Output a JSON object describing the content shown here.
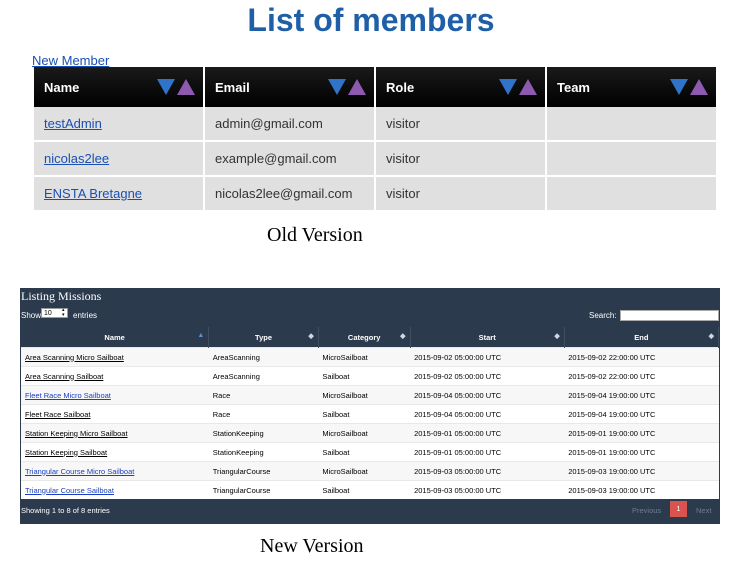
{
  "old": {
    "title": "List of members",
    "new_member_label": "New Member",
    "columns": [
      "Name",
      "Email",
      "Role",
      "Team"
    ],
    "rows": [
      {
        "name": "testAdmin",
        "email": "admin@gmail.com",
        "role": "visitor",
        "team": ""
      },
      {
        "name": "nicolas2lee",
        "email": "example@gmail.com",
        "role": "visitor",
        "team": ""
      },
      {
        "name": "ENSTA Bretagne",
        "email": "nicolas2lee@gmail.com",
        "role": "visitor",
        "team": ""
      }
    ],
    "caption": "Old Version"
  },
  "new": {
    "title": "Listing Missions",
    "show_label": "Show",
    "entries_value": "10",
    "entries_label": "entries",
    "search_label": "Search:",
    "search_value": "",
    "columns": [
      "Name",
      "Type",
      "Category",
      "Start",
      "End"
    ],
    "rows": [
      {
        "name": "Area Scanning Micro Sailboat",
        "type": "AreaScanning",
        "category": "MicroSailboat",
        "start": "2015-09-02 05:00:00 UTC",
        "end": "2015-09-02 22:00:00 UTC",
        "link_style": "visited"
      },
      {
        "name": "Area Scanning Sailboat",
        "type": "AreaScanning",
        "category": "Sailboat",
        "start": "2015-09-02 05:00:00 UTC",
        "end": "2015-09-02 22:00:00 UTC",
        "link_style": "visited"
      },
      {
        "name": "Fleet Race Micro Sailboat",
        "type": "Race",
        "category": "MicroSailboat",
        "start": "2015-09-04 05:00:00 UTC",
        "end": "2015-09-04 19:00:00 UTC",
        "link_style": "link"
      },
      {
        "name": "Fleet Race Sailboat",
        "type": "Race",
        "category": "Sailboat",
        "start": "2015-09-04 05:00:00 UTC",
        "end": "2015-09-04 19:00:00 UTC",
        "link_style": "visited"
      },
      {
        "name": "Station Keeping Micro Sailboat",
        "type": "StationKeeping",
        "category": "MicroSailboat",
        "start": "2015-09-01 05:00:00 UTC",
        "end": "2015-09-01 19:00:00 UTC",
        "link_style": "visited"
      },
      {
        "name": "Station Keeping Sailboat",
        "type": "StationKeeping",
        "category": "Sailboat",
        "start": "2015-09-01 05:00:00 UTC",
        "end": "2015-09-01 19:00:00 UTC",
        "link_style": "visited"
      },
      {
        "name": "Triangular Course Micro Sailboat",
        "type": "TriangularCourse",
        "category": "MicroSailboat",
        "start": "2015-09-03 05:00:00 UTC",
        "end": "2015-09-03 19:00:00 UTC",
        "link_style": "link"
      },
      {
        "name": "Triangular Course Sailboat",
        "type": "TriangularCourse",
        "category": "Sailboat",
        "start": "2015-09-03 05:00:00 UTC",
        "end": "2015-09-03 19:00:00 UTC",
        "link_style": "link"
      }
    ],
    "showing_info": "Showing 1 to 8 of 8 entries",
    "pagination": {
      "previous": "Previous",
      "page": "1",
      "next": "Next"
    },
    "caption": "New Version"
  },
  "colors": {
    "title_blue": "#1f5fa8",
    "panel_bg": "#2b3a4c",
    "page_active": "#d9534f",
    "sort_down": "#2f74c9",
    "sort_up": "#8d5ab0"
  }
}
